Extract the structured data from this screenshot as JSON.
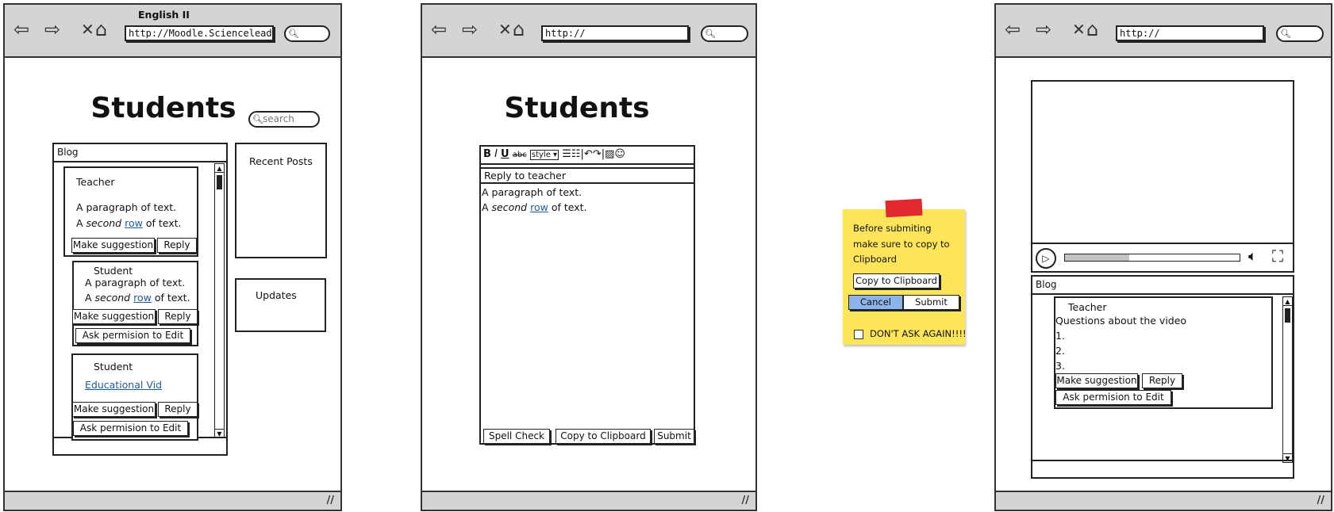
{
  "screens": [
    {
      "title": "English II",
      "url": "http://Moodle.Scienceleadership",
      "heading": "Students",
      "search_placeholder": "search",
      "blog": {
        "header": "Blog",
        "posts": [
          {
            "author": "Teacher",
            "line1": "A paragraph of text.",
            "line2_pre": "A ",
            "line2_em": "second",
            "line2_link": "row",
            "line2_post": " of text.",
            "suggest": "Make suggestion",
            "reply": "Reply"
          },
          {
            "author": "Student",
            "line1": "A paragraph of text.",
            "line2_pre": "A ",
            "line2_em": "second",
            "line2_link": "row",
            "line2_post": " of text.",
            "suggest": "Make suggestion",
            "reply": "Reply",
            "ask": "Ask permision to Edit"
          },
          {
            "author": "Student",
            "link": "Educational Vid",
            "suggest": "Make suggestion",
            "reply": "Reply",
            "ask": "Ask permision to Edit"
          }
        ]
      },
      "recent_posts": "Recent Posts",
      "updates": "Updates"
    },
    {
      "url": "http://",
      "heading": "Students",
      "editor": {
        "toolbar": {
          "bold": "B",
          "italic": "I",
          "underline": "U",
          "strike": "abc",
          "style": "style"
        },
        "subject": "Reply to teacher",
        "line1": "A paragraph of text.",
        "line2_pre": "A ",
        "line2_em": "second",
        "line2_link": "row",
        "line2_post": " of text.",
        "spell_check": "Spell Check",
        "copy": "Copy to Clipboard",
        "submit": "Submit"
      }
    },
    {
      "url": "http://",
      "video": {
        "progress_percent": 37
      },
      "blog": {
        "header": "Blog",
        "author": "Teacher",
        "text": "Questions about the video",
        "items": [
          "1.",
          "2.",
          "3."
        ],
        "suggest": "Make suggestion",
        "reply": "Reply",
        "ask": "Ask permision to Edit"
      }
    }
  ],
  "sticky": {
    "line1": "Before submiting",
    "line2": "make sure to copy to",
    "line3": "Clipboard",
    "copy": "Copy to Clipboard",
    "cancel": "Cancel",
    "submit": "Submit",
    "checkbox": "DON'T ASK AGAIN!!!!",
    "checked": false,
    "color": "#fde55a",
    "tape_color": "#e0282e",
    "cancel_color": "#8cb4ea"
  },
  "icons": {
    "back": "arrow-left-icon",
    "forward": "arrow-right-icon",
    "stop": "close-icon",
    "home": "home-icon",
    "search": "search-icon"
  }
}
